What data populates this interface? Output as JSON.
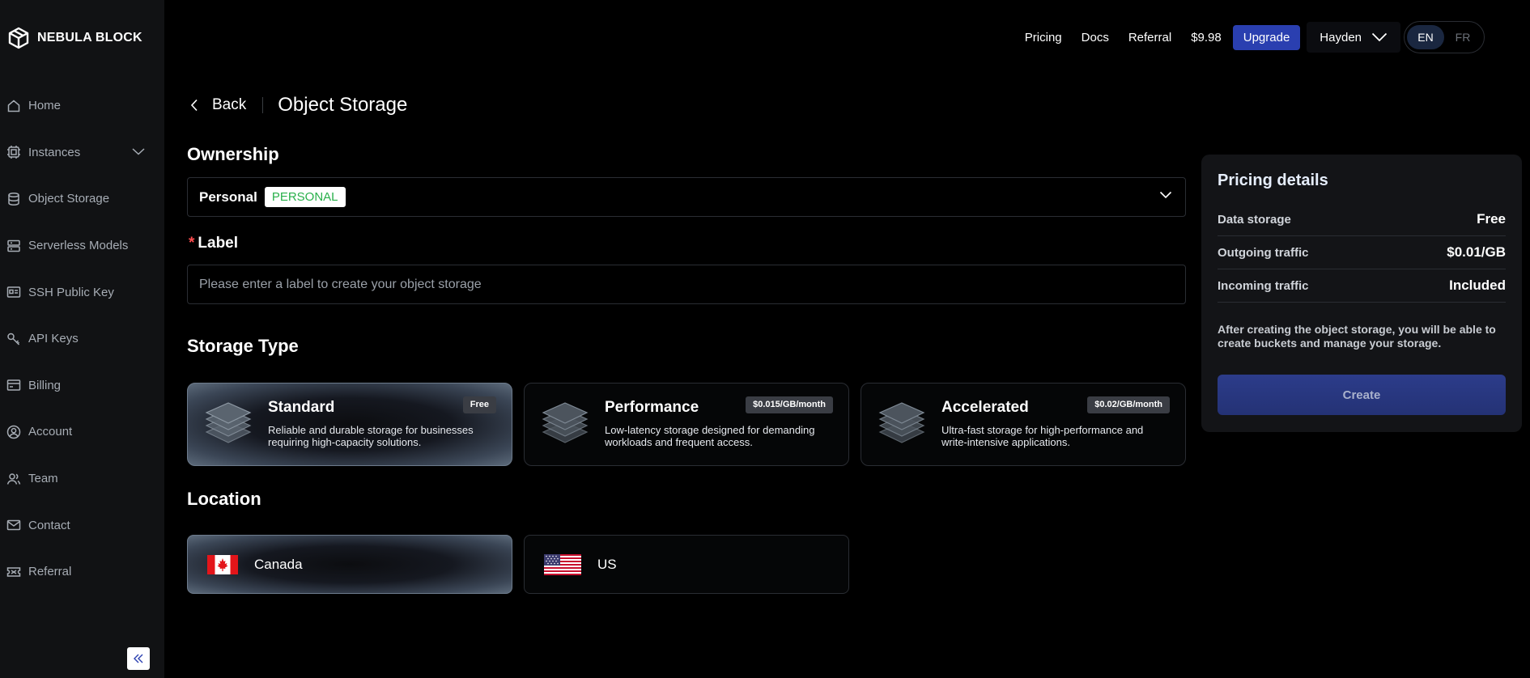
{
  "brand": {
    "name": "NEBULA BLOCK"
  },
  "sidebar": {
    "items": [
      {
        "label": "Home",
        "icon": "home-icon"
      },
      {
        "label": "Instances",
        "icon": "cpu-icon",
        "expandable": true
      },
      {
        "label": "Object Storage",
        "icon": "database-icon"
      },
      {
        "label": "Serverless Models",
        "icon": "server-icon"
      },
      {
        "label": "SSH Public Key",
        "icon": "id-card-icon"
      },
      {
        "label": "API Keys",
        "icon": "key-icon"
      },
      {
        "label": "Billing",
        "icon": "billing-icon"
      },
      {
        "label": "Account",
        "icon": "user-circle-icon"
      },
      {
        "label": "Team",
        "icon": "team-icon"
      },
      {
        "label": "Contact",
        "icon": "mail-icon"
      },
      {
        "label": "Referral",
        "icon": "ticket-icon"
      }
    ]
  },
  "topbar": {
    "pricing": "Pricing",
    "docs": "Docs",
    "referral": "Referral",
    "balance": "$9.98",
    "upgrade": "Upgrade",
    "user": "Hayden",
    "lang_en": "EN",
    "lang_fr": "FR"
  },
  "header": {
    "back": "Back",
    "title": "Object Storage"
  },
  "ownership": {
    "title": "Ownership",
    "value": "Personal",
    "badge": "PERSONAL"
  },
  "label": {
    "title": "Label",
    "placeholder": "Please enter a label to create your object storage"
  },
  "storage_type": {
    "title": "Storage Type",
    "cards": [
      {
        "title": "Standard",
        "badge": "Free",
        "desc": "Reliable and durable storage for businesses requiring high-capacity solutions.",
        "selected": true
      },
      {
        "title": "Performance",
        "badge": "$0.015/GB/month",
        "desc": "Low-latency storage designed for demanding workloads and frequent access.",
        "selected": false
      },
      {
        "title": "Accelerated",
        "badge": "$0.02/GB/month",
        "desc": "Ultra-fast storage for high-performance and write-intensive applications.",
        "selected": false
      }
    ]
  },
  "location": {
    "title": "Location",
    "options": [
      {
        "name": "Canada",
        "selected": true
      },
      {
        "name": "US",
        "selected": false
      }
    ]
  },
  "pricing": {
    "title": "Pricing details",
    "rows": [
      {
        "key": "Data storage",
        "value": "Free"
      },
      {
        "key": "Outgoing traffic",
        "value": "$0.01/GB"
      },
      {
        "key": "Incoming traffic",
        "value": "Included"
      }
    ],
    "note": "After creating the object storage, you will be able to create buckets and manage your storage.",
    "create": "Create"
  },
  "colors": {
    "accent": "#2a3fb0",
    "success": "#28b04a",
    "required": "#ff4d4f"
  }
}
